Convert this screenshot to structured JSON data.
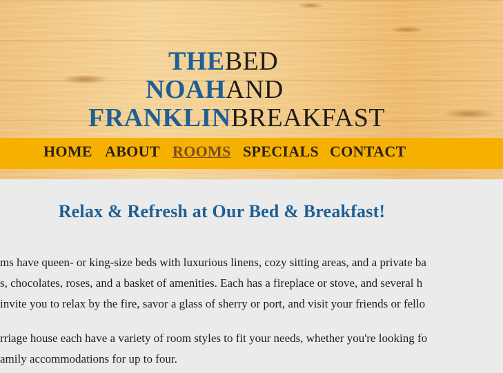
{
  "logo": {
    "line1_blue": "THE",
    "line1_dark": "BED",
    "line2_blue": "NOAH",
    "line2_dark": "AND",
    "line3_blue": "FRANKLIN",
    "line3_dark": "BREAKFAST"
  },
  "nav": {
    "items": [
      {
        "label": "HOME"
      },
      {
        "label": "ABOUT"
      },
      {
        "label": "ROOMS",
        "active": true
      },
      {
        "label": "SPECIALS"
      },
      {
        "label": "CONTACT"
      }
    ]
  },
  "main": {
    "title": "Relax & Refresh at Our Bed & Breakfast!",
    "paragraph1": [
      "ms have queen- or king-size beds with luxurious linens, cozy sitting areas, and a private ba",
      "s, chocolates, roses, and a basket of amenities. Each has a fireplace or stove, and several h",
      " invite you to relax by the fire, savor a glass of sherry or port, and visit your friends or fello"
    ],
    "paragraph2": [
      "rriage house each have a variety of room styles to fit your needs, whether you're looking fo",
      "amily accommodations for up to four."
    ]
  },
  "colors": {
    "brand_blue": "#1f5f95",
    "nav_bar": "#f6b100",
    "text_dark": "#1e1d1a",
    "page_bg": "#ebebeb"
  }
}
